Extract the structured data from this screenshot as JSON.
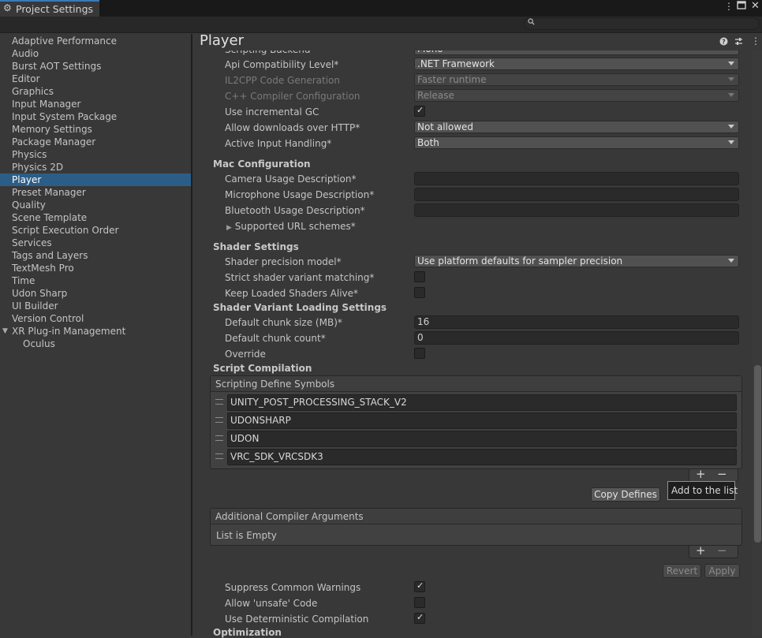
{
  "window": {
    "title": "Project Settings",
    "title_icon": "gear-icon",
    "menu_icon": "more-vertical-icon",
    "maximize_icon": "maximize-icon",
    "close_icon": "close-icon"
  },
  "search": {
    "placeholder": "",
    "icon": "search-icon"
  },
  "sidebar": {
    "items": [
      {
        "label": "Adaptive Performance"
      },
      {
        "label": "Audio"
      },
      {
        "label": "Burst AOT Settings"
      },
      {
        "label": "Editor"
      },
      {
        "label": "Graphics"
      },
      {
        "label": "Input Manager"
      },
      {
        "label": "Input System Package"
      },
      {
        "label": "Memory Settings"
      },
      {
        "label": "Package Manager"
      },
      {
        "label": "Physics"
      },
      {
        "label": "Physics 2D"
      },
      {
        "label": "Player",
        "selected": true
      },
      {
        "label": "Preset Manager"
      },
      {
        "label": "Quality"
      },
      {
        "label": "Scene Template"
      },
      {
        "label": "Script Execution Order"
      },
      {
        "label": "Services"
      },
      {
        "label": "Tags and Layers"
      },
      {
        "label": "TextMesh Pro"
      },
      {
        "label": "Time"
      },
      {
        "label": "Udon Sharp"
      },
      {
        "label": "UI Builder"
      },
      {
        "label": "Version Control"
      },
      {
        "label": "XR Plug-in Management",
        "expanded": true
      },
      {
        "label": "Oculus"
      }
    ]
  },
  "header": {
    "title": "Player",
    "help_icon": "help-icon",
    "presets_icon": "presets-icon",
    "menu_icon": "more-vertical-icon"
  },
  "other": {
    "scripting_backend_label": "Scripting Backend",
    "scripting_backend_value": "Mono",
    "api_label": "Api Compatibility Level*",
    "api_value": ".NET Framework",
    "il2cpp_label": "IL2CPP Code Generation",
    "il2cpp_value": "Faster runtime",
    "cpp_label": "C++ Compiler Configuration",
    "cpp_value": "Release",
    "incgc_label": "Use incremental GC",
    "incgc_checked": true,
    "http_label": "Allow downloads over HTTP*",
    "http_value": "Not allowed",
    "input_label": "Active Input Handling*",
    "input_value": "Both"
  },
  "mac": {
    "heading": "Mac Configuration",
    "camera_label": "Camera Usage Description*",
    "camera_value": "",
    "mic_label": "Microphone Usage Description*",
    "mic_value": "",
    "bt_label": "Bluetooth Usage Description*",
    "bt_value": "",
    "url_label": "Supported URL schemes*"
  },
  "shader": {
    "heading": "Shader Settings",
    "precision_label": "Shader precision model*",
    "precision_value": "Use platform defaults for sampler precision",
    "strict_label": "Strict shader variant matching*",
    "strict_checked": false,
    "keep_label": "Keep Loaded Shaders Alive*",
    "keep_checked": false
  },
  "variant": {
    "heading": "Shader Variant Loading Settings",
    "chunk_size_label": "Default chunk size (MB)*",
    "chunk_size_value": "16",
    "chunk_count_label": "Default chunk count*",
    "chunk_count_value": "0",
    "override_label": "Override",
    "override_checked": false
  },
  "script": {
    "heading": "Script Compilation",
    "defines_header": "Scripting Define Symbols",
    "defines": [
      "UNITY_POST_PROCESSING_STACK_V2",
      "UDONSHARP",
      "UDON",
      "VRC_SDK_VRCSDK3"
    ],
    "plus": "+",
    "minus": "−",
    "copy_defines": "Copy Defines",
    "tooltip": "Add to the list",
    "args_header": "Additional Compiler Arguments",
    "args_empty": "List is Empty",
    "revert": "Revert",
    "apply": "Apply",
    "suppress_label": "Suppress Common Warnings",
    "suppress_checked": true,
    "unsafe_label": "Allow 'unsafe' Code",
    "unsafe_checked": false,
    "deterministic_label": "Use Deterministic Compilation",
    "deterministic_checked": true
  },
  "optimization": {
    "heading": "Optimization"
  }
}
